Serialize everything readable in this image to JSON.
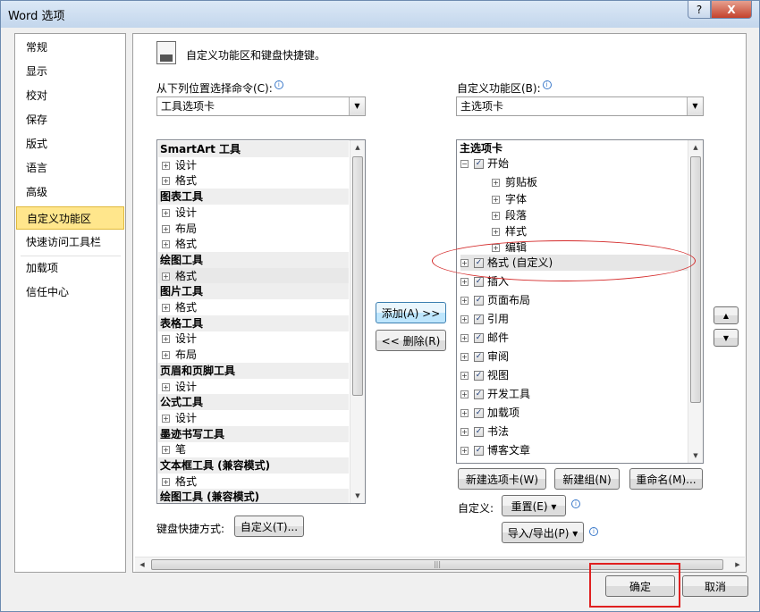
{
  "window": {
    "title": "Word 选项",
    "help": "?",
    "close": "X"
  },
  "nav": {
    "items": [
      "常规",
      "显示",
      "校对",
      "保存",
      "版式",
      "语言",
      "高级",
      "自定义功能区",
      "快速访问工具栏",
      "加载项",
      "信任中心"
    ],
    "selected": "自定义功能区"
  },
  "header": {
    "title": "自定义功能区和键盘快捷键。"
  },
  "left": {
    "label": "从下列位置选择命令(C):",
    "combo_value": "工具选项卡",
    "rows": [
      {
        "t": "g",
        "text": "SmartArt 工具"
      },
      {
        "t": "c",
        "text": "设计"
      },
      {
        "t": "c",
        "text": "格式"
      },
      {
        "t": "g",
        "text": "图表工具"
      },
      {
        "t": "c",
        "text": "设计"
      },
      {
        "t": "c",
        "text": "布局"
      },
      {
        "t": "c",
        "text": "格式"
      },
      {
        "t": "g",
        "text": "绘图工具"
      },
      {
        "t": "c",
        "text": "格式",
        "highlight": true
      },
      {
        "t": "g",
        "text": "图片工具"
      },
      {
        "t": "c",
        "text": "格式"
      },
      {
        "t": "g",
        "text": "表格工具"
      },
      {
        "t": "c",
        "text": "设计"
      },
      {
        "t": "c",
        "text": "布局"
      },
      {
        "t": "g",
        "text": "页眉和页脚工具"
      },
      {
        "t": "c",
        "text": "设计"
      },
      {
        "t": "g",
        "text": "公式工具"
      },
      {
        "t": "c",
        "text": "设计"
      },
      {
        "t": "g",
        "text": "墨迹书写工具"
      },
      {
        "t": "c",
        "text": "笔"
      },
      {
        "t": "g",
        "text": "文本框工具 (兼容模式)"
      },
      {
        "t": "c",
        "text": "格式"
      },
      {
        "t": "g",
        "text": "绘图工具 (兼容模式)"
      }
    ]
  },
  "middle": {
    "add": "添加(A) >>",
    "remove": "<< 删除(R)"
  },
  "right": {
    "label": "自定义功能区(B):",
    "combo_value": "主选项卡",
    "header": "主选项卡",
    "rows": [
      {
        "level": 0,
        "exp": "⊟",
        "check": true,
        "text": "开始"
      },
      {
        "level": 1,
        "exp": "⊞",
        "check": false,
        "text": "剪贴板"
      },
      {
        "level": 1,
        "exp": "⊞",
        "check": false,
        "text": "字体"
      },
      {
        "level": 1,
        "exp": "⊞",
        "check": false,
        "text": "段落"
      },
      {
        "level": 1,
        "exp": "⊞",
        "check": false,
        "text": "样式"
      },
      {
        "level": 1,
        "exp": "⊞",
        "check": false,
        "text": "编辑"
      },
      {
        "level": 0,
        "exp": "⊞",
        "check": true,
        "text": "格式 (自定义)",
        "highlight": true
      },
      {
        "level": 0,
        "exp": "⊞",
        "check": true,
        "text": "插入"
      },
      {
        "level": 0,
        "exp": "⊞",
        "check": true,
        "text": "页面布局"
      },
      {
        "level": 0,
        "exp": "⊞",
        "check": true,
        "text": "引用"
      },
      {
        "level": 0,
        "exp": "⊞",
        "check": true,
        "text": "邮件"
      },
      {
        "level": 0,
        "exp": "⊞",
        "check": true,
        "text": "审阅"
      },
      {
        "level": 0,
        "exp": "⊞",
        "check": true,
        "text": "视图"
      },
      {
        "level": 0,
        "exp": "⊞",
        "check": true,
        "text": "开发工具"
      },
      {
        "level": 0,
        "exp": "⊞",
        "check": true,
        "text": "加载项"
      },
      {
        "level": 0,
        "exp": "⊞",
        "check": true,
        "text": "书法"
      },
      {
        "level": 0,
        "exp": "⊞",
        "check": true,
        "text": "博客文章"
      }
    ],
    "new_tab": "新建选项卡(W)",
    "new_group": "新建组(N)",
    "rename": "重命名(M)...",
    "customize_label": "自定义:",
    "reset": "重置(E) ▾",
    "import_export": "导入/导出(P) ▾"
  },
  "keyboard": {
    "label": "键盘快捷方式:",
    "button": "自定义(T)..."
  },
  "footer": {
    "ok": "确定",
    "cancel": "取消"
  },
  "colors": {
    "nav_selected": "#ffe68c",
    "annotation": "#e02020"
  }
}
